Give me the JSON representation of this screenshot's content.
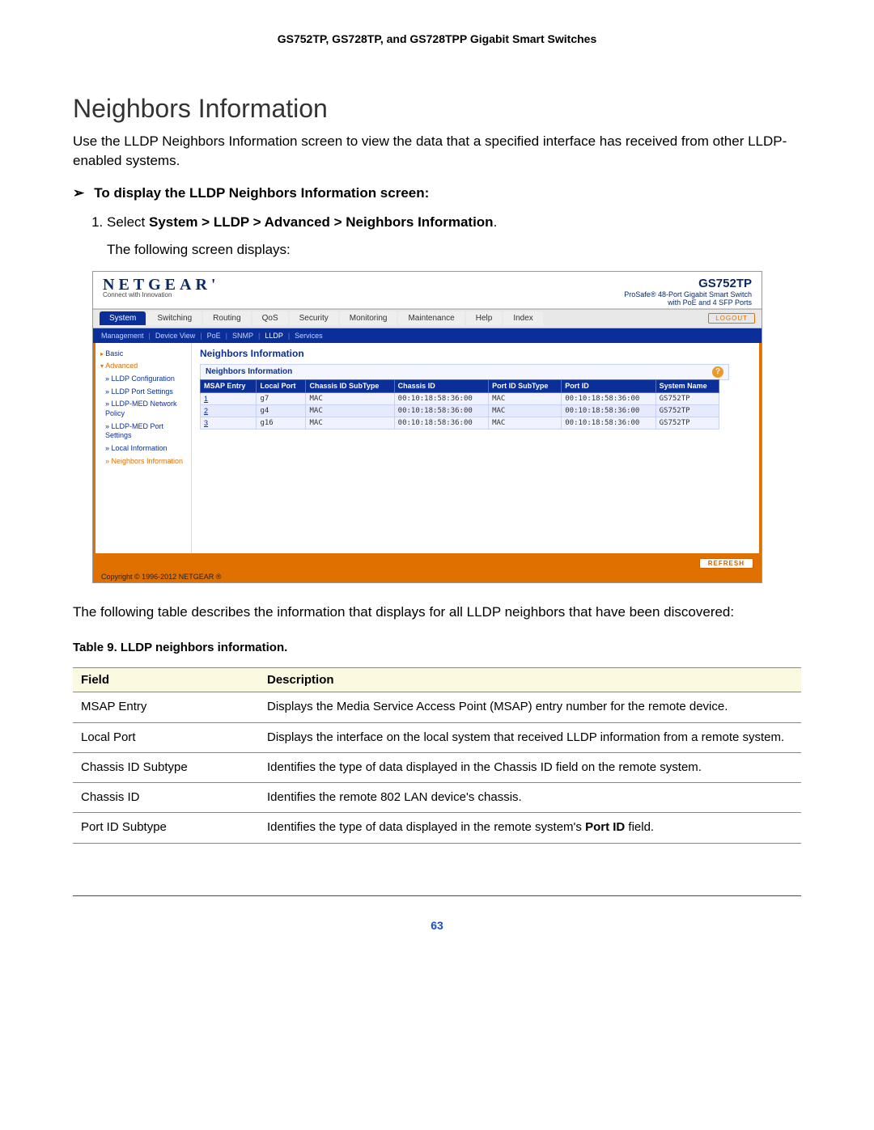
{
  "doc_header": "GS752TP, GS728TP, and GS728TPP Gigabit Smart Switches",
  "section_title": "Neighbors Information",
  "intro": "Use the LLDP Neighbors Information screen to view the data that a specified interface has received from other LLDP-enabled systems.",
  "procedure_title": "To display the LLDP Neighbors Information screen:",
  "step_prefix": "Select ",
  "step_path": "System > LLDP > Advanced > Neighbors Information",
  "step_suffix": ".",
  "step_followup": "The following screen displays:",
  "screenshot": {
    "logo": "NETGEAR",
    "logo_sub": "Connect with Innovation",
    "model": "GS752TP",
    "model_desc1": "ProSafe® 48-Port Gigabit Smart Switch",
    "model_desc2": "with PoE and 4 SFP Ports",
    "tabs": [
      "System",
      "Switching",
      "Routing",
      "QoS",
      "Security",
      "Monitoring",
      "Maintenance",
      "Help",
      "Index"
    ],
    "active_tab_index": 0,
    "logout": "LOGOUT",
    "subnav": [
      "Management",
      "Device View",
      "PoE",
      "SNMP",
      "LLDP",
      "Services"
    ],
    "sidebar": {
      "basic": "Basic",
      "advanced": "Advanced",
      "items": [
        "LLDP Configuration",
        "LLDP Port Settings",
        "LLDP-MED Network Policy",
        "LLDP-MED Port Settings",
        "Local Information",
        "Neighbors Information"
      ],
      "selected_index": 5
    },
    "content_title": "Neighbors Information",
    "sub_title": "Neighbors Information",
    "columns": [
      "MSAP Entry",
      "Local Port",
      "Chassis ID SubType",
      "Chassis ID",
      "Port ID SubType",
      "Port ID",
      "System Name"
    ],
    "rows": [
      {
        "msap": "1",
        "local": "g7",
        "cstype": "MAC",
        "cid": "00:10:18:58:36:00",
        "pstype": "MAC",
        "pid": "00:10:18:58:36:00",
        "sys": "GS752TP"
      },
      {
        "msap": "2",
        "local": "g4",
        "cstype": "MAC",
        "cid": "00:10:18:58:36:00",
        "pstype": "MAC",
        "pid": "00:10:18:58:36:00",
        "sys": "GS752TP"
      },
      {
        "msap": "3",
        "local": "g16",
        "cstype": "MAC",
        "cid": "00:10:18:58:36:00",
        "pstype": "MAC",
        "pid": "00:10:18:58:36:00",
        "sys": "GS752TP"
      }
    ],
    "refresh": "REFRESH",
    "copyright": "Copyright © 1996-2012 NETGEAR ®"
  },
  "after_shot": "The following table describes the information that displays for all LLDP neighbors that have been discovered:",
  "table_caption": "Table 9.  LLDP neighbors information.",
  "field_header": "Field",
  "desc_header": "Description",
  "fields": [
    {
      "f": "MSAP Entry",
      "d": "Displays the Media Service Access Point (MSAP) entry number for the remote device."
    },
    {
      "f": "Local Port",
      "d": "Displays the interface on the local system that received LLDP information from a remote system."
    },
    {
      "f": "Chassis ID Subtype",
      "d": "Identifies the type of data displayed in the Chassis ID field on the remote system."
    },
    {
      "f": "Chassis ID",
      "d": "Identifies the remote 802 LAN device's chassis."
    },
    {
      "f": "Port ID Subtype",
      "d_pre": "Identifies the type of data displayed in the remote system's ",
      "d_bold": "Port ID",
      "d_post": " field."
    }
  ],
  "page_number": "63"
}
